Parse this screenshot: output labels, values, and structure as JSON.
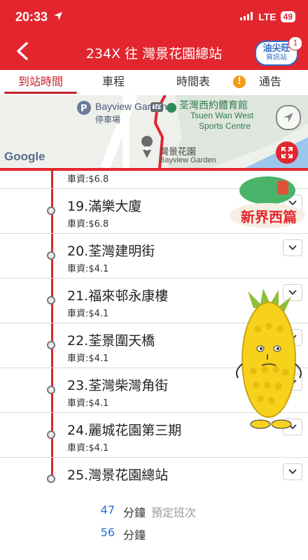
{
  "status_bar": {
    "time": "20:33",
    "network": "LTE",
    "battery": "49"
  },
  "header": {
    "title": "234X 往 灣景花園總站",
    "badge_line1": "油尖旺",
    "badge_line2": "資訊站",
    "badge_count": "1"
  },
  "tabs": [
    {
      "label": "到站時間",
      "active": true
    },
    {
      "label": "車程",
      "active": false
    },
    {
      "label": "時間表",
      "active": false
    },
    {
      "label": "通告",
      "active": false
    }
  ],
  "map": {
    "google_logo": "Google",
    "labels": {
      "bayview_garden_parking": "Bayview Garden",
      "parking_zh": "停車場",
      "sports_centre_zh": "荃灣西約體育館",
      "sports_centre_en1": "Tsuen Wan West",
      "sports_centre_en2": "Sports Centre",
      "stop_zh": "灣景花園",
      "stop_en": "Bayview Garden"
    }
  },
  "stops": [
    {
      "name": "",
      "fare": "車資:$6.8"
    },
    {
      "name": "19.滿樂大廈",
      "fare": "車資:$6.8"
    },
    {
      "name": "20.荃灣建明街",
      "fare": "車資:$4.1"
    },
    {
      "name": "21.福來邨永康樓",
      "fare": "車資:$4.1"
    },
    {
      "name": "22.荃景圍天橋",
      "fare": "車資:$4.1"
    },
    {
      "name": "23.荃灣柴灣角街",
      "fare": "車資:$4.1"
    },
    {
      "name": "24.麗城花園第三期",
      "fare": "車資:$4.1"
    },
    {
      "name": "25.灣景花園總站",
      "fare": ""
    }
  ],
  "eta": [
    {
      "minutes": "47",
      "unit": "分鐘",
      "note": "預定班次"
    },
    {
      "minutes": "56",
      "unit": "分鐘",
      "note": ""
    }
  ],
  "promo": {
    "text": "新界西篇"
  }
}
